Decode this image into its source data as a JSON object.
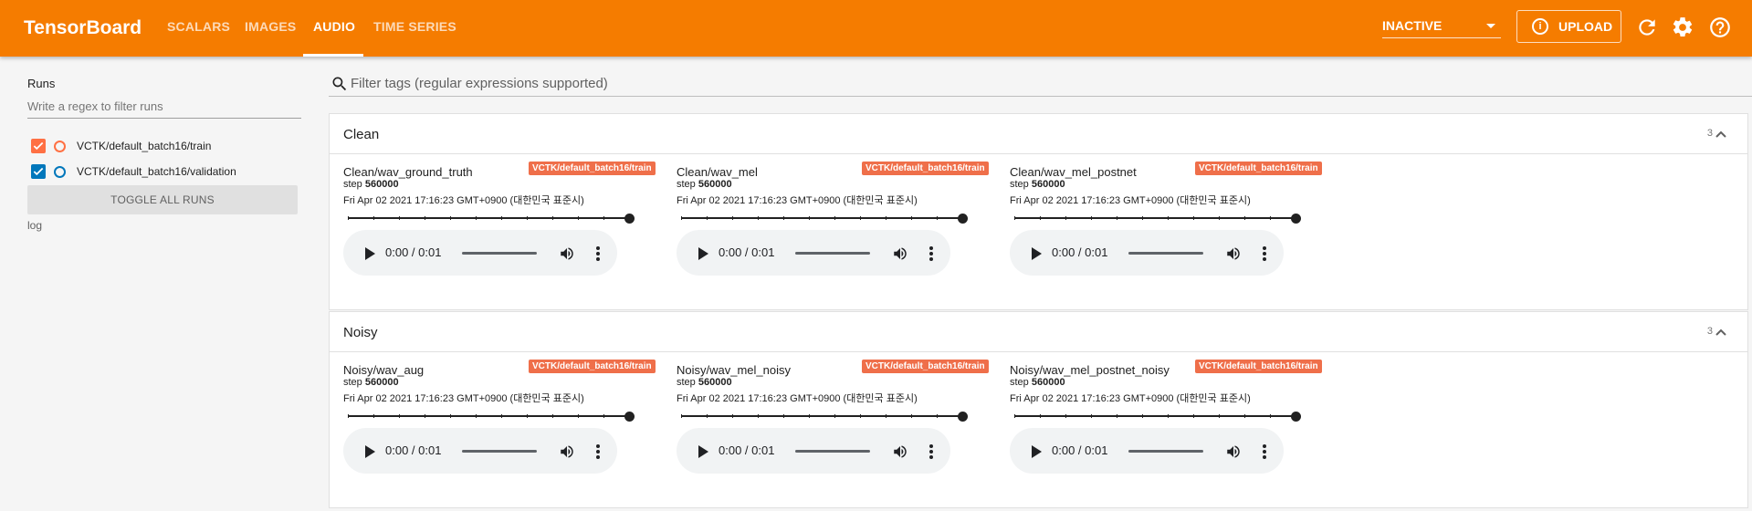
{
  "app": {
    "brand": "TensorBoard",
    "tabs": [
      {
        "label": "SCALARS",
        "active": false
      },
      {
        "label": "IMAGES",
        "active": false
      },
      {
        "label": "AUDIO",
        "active": true
      },
      {
        "label": "TIME SERIES",
        "active": false
      }
    ],
    "status_select": "INACTIVE",
    "upload_label": "UPLOAD",
    "accent_color": "#f57c00"
  },
  "sidebar": {
    "title": "Runs",
    "filter_placeholder": "Write a regex to filter runs",
    "runs": [
      {
        "label": "VCTK/default_batch16/train",
        "checked": true,
        "color": "#ff7043"
      },
      {
        "label": "VCTK/default_batch16/validation",
        "checked": true,
        "color": "#0077bb"
      }
    ],
    "toggle_all": "TOGGLE ALL RUNS",
    "log_dir": "log"
  },
  "main": {
    "tag_filter_placeholder": "Filter tags (regular expressions supported)",
    "groups": [
      {
        "title": "Clean",
        "count": "3",
        "cards": [
          {
            "tag": "Clean/wav_ground_truth",
            "run": "VCTK/default_batch16/train",
            "step_label": "step",
            "step": "560000",
            "time": "Fri Apr 02 2021 17:16:23 GMT+0900 (대한민국 표준시)",
            "player_time": "0:00 / 0:01"
          },
          {
            "tag": "Clean/wav_mel",
            "run": "VCTK/default_batch16/train",
            "step_label": "step",
            "step": "560000",
            "time": "Fri Apr 02 2021 17:16:23 GMT+0900 (대한민국 표준시)",
            "player_time": "0:00 / 0:01"
          },
          {
            "tag": "Clean/wav_mel_postnet",
            "run": "VCTK/default_batch16/train",
            "step_label": "step",
            "step": "560000",
            "time": "Fri Apr 02 2021 17:16:23 GMT+0900 (대한민국 표준시)",
            "player_time": "0:00 / 0:01"
          }
        ]
      },
      {
        "title": "Noisy",
        "count": "3",
        "cards": [
          {
            "tag": "Noisy/wav_aug",
            "run": "VCTK/default_batch16/train",
            "step_label": "step",
            "step": "560000",
            "time": "Fri Apr 02 2021 17:16:23 GMT+0900 (대한민국 표준시)",
            "player_time": "0:00 / 0:01"
          },
          {
            "tag": "Noisy/wav_mel_noisy",
            "run": "VCTK/default_batch16/train",
            "step_label": "step",
            "step": "560000",
            "time": "Fri Apr 02 2021 17:16:23 GMT+0900 (대한민국 표준시)",
            "player_time": "0:00 / 0:01"
          },
          {
            "tag": "Noisy/wav_mel_postnet_noisy",
            "run": "VCTK/default_batch16/train",
            "step_label": "step",
            "step": "560000",
            "time": "Fri Apr 02 2021 17:16:23 GMT+0900 (대한민국 표준시)",
            "player_time": "0:00 / 0:01"
          }
        ]
      }
    ]
  }
}
